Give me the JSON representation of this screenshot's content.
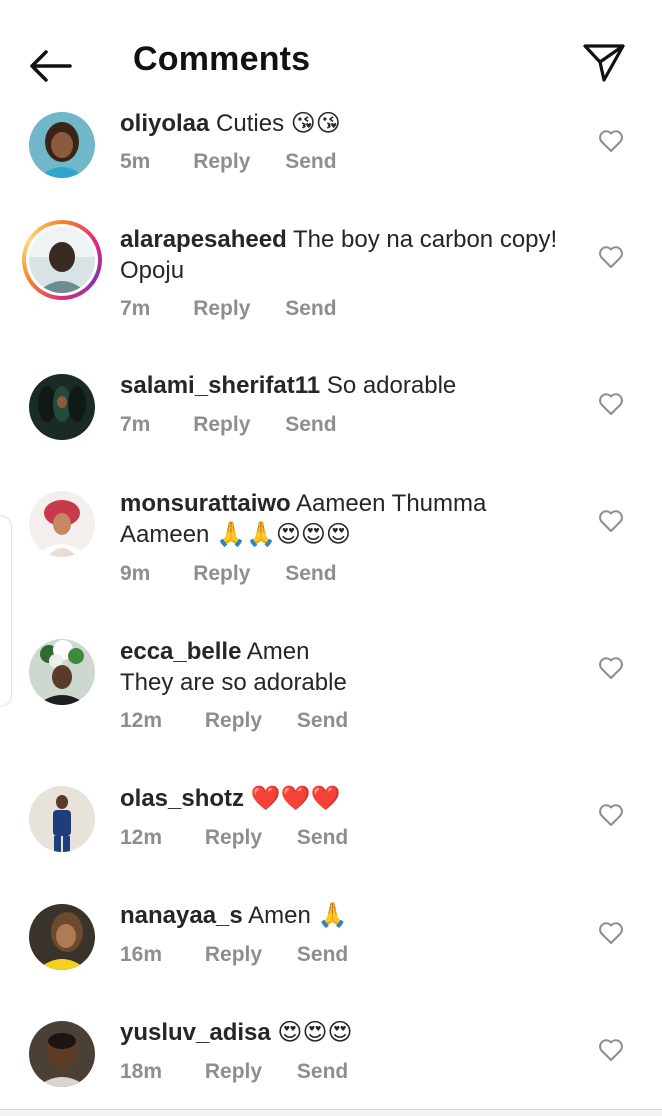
{
  "header": {
    "title": "Comments"
  },
  "comments": [
    {
      "username": "oliyolaa",
      "text": "Cuties",
      "emoji": "😘😘",
      "time": "5m",
      "reply": "Reply",
      "send": "Send"
    },
    {
      "username": "alarapesaheed",
      "text": "The boy na carbon copy! Opoju",
      "emoji": "",
      "time": "7m",
      "reply": "Reply",
      "send": "Send"
    },
    {
      "username": "salami_sherifat11",
      "text": "So adorable",
      "emoji": "",
      "time": "7m",
      "reply": "Reply",
      "send": "Send"
    },
    {
      "username": "monsurattaiwo",
      "text": "Aameen Thumma Aameen",
      "emoji": "🙏🙏😍😍😍",
      "time": "9m",
      "reply": "Reply",
      "send": "Send"
    },
    {
      "username": "ecca_belle",
      "text": "Amen",
      "text2": "They are so adorable",
      "emoji": "",
      "time": "12m",
      "reply": "Reply",
      "send": "Send"
    },
    {
      "username": "olas_shotz",
      "text": "",
      "emoji": "❤️❤️❤️",
      "time": "12m",
      "reply": "Reply",
      "send": "Send"
    },
    {
      "username": "nanayaa_s",
      "text": "Amen",
      "emoji": "🙏",
      "time": "16m",
      "reply": "Reply",
      "send": "Send"
    },
    {
      "username": "yusluv_adisa",
      "text": "",
      "emoji": "😍😍😍",
      "time": "18m",
      "reply": "Reply",
      "send": "Send"
    }
  ],
  "icons": {
    "back": "arrow-left-icon",
    "share": "paper-plane-icon",
    "like": "heart-outline-icon"
  },
  "colors": {
    "text": "#262626",
    "secondary": "#8e8e8e",
    "heart": "#8e8e8e",
    "story_ring_start": "#f58529",
    "story_ring_end": "#dd2a7b"
  }
}
